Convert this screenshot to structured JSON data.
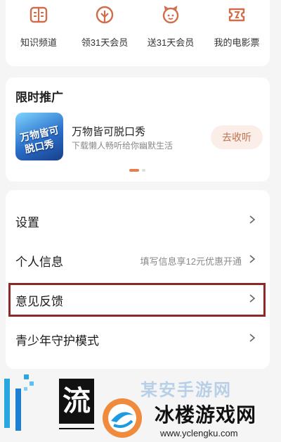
{
  "quick_links": [
    {
      "label": "知识频道",
      "icon": "book-icon"
    },
    {
      "label": "领31天会员",
      "icon": "tree-gift-icon"
    },
    {
      "label": "送31天会员",
      "icon": "piggy-gift-icon"
    },
    {
      "label": "我的电影票",
      "icon": "ticket-icon"
    }
  ],
  "promo": {
    "title": "限时推广",
    "art_text_1": "万物皆可",
    "art_text_2": "脱口秀",
    "name": "万物皆可脱口秀",
    "description": "下载懒人畅听给你幽默生活",
    "button": "去收听"
  },
  "menu": [
    {
      "label": "设置",
      "hint": ""
    },
    {
      "label": "个人信息",
      "hint": "填写信息享12元优惠开通"
    },
    {
      "label": "意见反馈",
      "hint": ""
    },
    {
      "label": "青少年守护模式",
      "hint": ""
    }
  ],
  "watermark": {
    "glyph": "流",
    "ghost_text": "某安手游网",
    "title": "冰楼游戏网",
    "url": "www.yclengku.com"
  },
  "colors": {
    "accent": "#e57e50",
    "icon": "#d06d4a",
    "highlight_border": "#8b2b27",
    "promo_button_bg": "#fbeee8"
  }
}
